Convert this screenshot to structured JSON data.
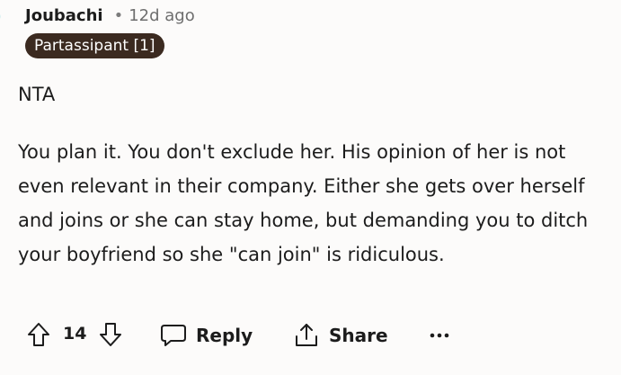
{
  "comment": {
    "author": "Joubachi",
    "separator": "•",
    "age": "12d ago",
    "flair": "Partassipant [1]",
    "paragraphs": [
      "NTA",
      "You plan it. You don't exclude her. His opinion of her is not even relevant in their company. Either she gets over herself and joins or she can stay home, but demanding you to ditch your boyfriend so she \"can join\" is ridiculous."
    ]
  },
  "actions": {
    "score": "14",
    "reply_label": "Reply",
    "share_label": "Share",
    "more_label": "•••"
  },
  "icons": {
    "avatar": "avatar-icon",
    "upvote": "upvote-arrow-icon",
    "downvote": "downvote-arrow-icon",
    "reply": "speech-bubble-icon",
    "share": "share-icon",
    "more": "overflow-dots-icon"
  },
  "colors": {
    "flair_background": "#3b2a20",
    "avatar_accent": "#46c3c9",
    "background": "#fcfbfa"
  }
}
